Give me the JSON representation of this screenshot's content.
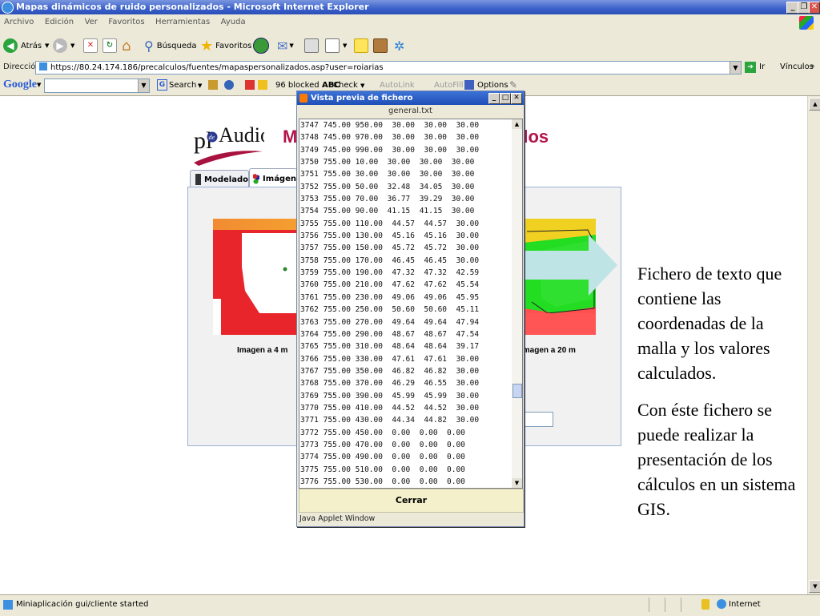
{
  "window": {
    "title": "Mapas dinámicos de ruido personalizados - Microsoft Internet Explorer",
    "minimize": "_",
    "restore": "❐",
    "close": "✕"
  },
  "menu": [
    "Archivo",
    "Edición",
    "Ver",
    "Favoritos",
    "Herramientas",
    "Ayuda"
  ],
  "toolbar": {
    "back": "Atrás",
    "search": "Búsqueda",
    "favorites": "Favoritos"
  },
  "address": {
    "label": "Dirección",
    "url": "https://80.24.174.186/precalculos/fuentes/mapaspersonalizados.asp?user=roiarias",
    "go": "Ir",
    "links": "Vínculos"
  },
  "googlebar": {
    "brand": "Google",
    "search": "Search",
    "blocked": "96 blocked",
    "check": "Check",
    "autolink": "AutoLink",
    "autofill": "AutoFill",
    "options": "Options"
  },
  "page": {
    "title_left": "M",
    "title_right": "dos",
    "logo_text": "Audio",
    "logo_prefix": "pl",
    "logo_mid": "de",
    "tabs": [
      "Modelado",
      "Imágen"
    ],
    "map_left_label": "Imagen a 4 m",
    "map_right_label": "Imagen a 20 m"
  },
  "dialog": {
    "title": "Vista previa de fichero",
    "filename": "general.txt",
    "rows": [
      "3747 745.00 950.00  30.00  30.00  30.00",
      "3748 745.00 970.00  30.00  30.00  30.00",
      "3749 745.00 990.00  30.00  30.00  30.00",
      "3750 755.00 10.00  30.00  30.00  30.00",
      "3751 755.00 30.00  30.00  30.00  30.00",
      "3752 755.00 50.00  32.48  34.05  30.00",
      "3753 755.00 70.00  36.77  39.29  30.00",
      "3754 755.00 90.00  41.15  41.15  30.00",
      "3755 755.00 110.00  44.57  44.57  30.00",
      "3756 755.00 130.00  45.16  45.16  30.00",
      "3757 755.00 150.00  45.72  45.72  30.00",
      "3758 755.00 170.00  46.45  46.45  30.00",
      "3759 755.00 190.00  47.32  47.32  42.59",
      "3760 755.00 210.00  47.62  47.62  45.54",
      "3761 755.00 230.00  49.06  49.06  45.95",
      "3762 755.00 250.00  50.60  50.60  45.11",
      "3763 755.00 270.00  49.64  49.64  47.94",
      "3764 755.00 290.00  48.67  48.67  47.54",
      "3765 755.00 310.00  48.64  48.64  39.17",
      "3766 755.00 330.00  47.61  47.61  30.00",
      "3767 755.00 350.00  46.82  46.82  30.00",
      "3768 755.00 370.00  46.29  46.55  30.00",
      "3769 755.00 390.00  45.99  45.99  30.00",
      "3770 755.00 410.00  44.52  44.52  30.00",
      "3771 755.00 430.00  44.34  44.82  30.00",
      "3772 755.00 450.00  0.00  0.00  0.00",
      "3773 755.00 470.00  0.00  0.00  0.00",
      "3774 755.00 490.00  0.00  0.00  0.00",
      "3775 755.00 510.00  0.00  0.00  0.00",
      "3776 755.00 530.00  0.00  0.00  0.00"
    ],
    "close_button": "Cerrar",
    "status": "Java Applet Window"
  },
  "sidetext": {
    "para1": "Fichero de texto que contiene las coordenadas de la malla y los valores calculados.",
    "para2": "Con éste fichero se puede realizar la presentación de los cálculos en un sistema GIS."
  },
  "statusbar": {
    "left": "Miniaplicación gui/cliente started",
    "zone": "Internet"
  },
  "colors": {
    "accent_title": "#b4134a",
    "xp_blue": "#2a4eb8",
    "map_red": "#e8252a",
    "map_green": "#22dd22"
  }
}
